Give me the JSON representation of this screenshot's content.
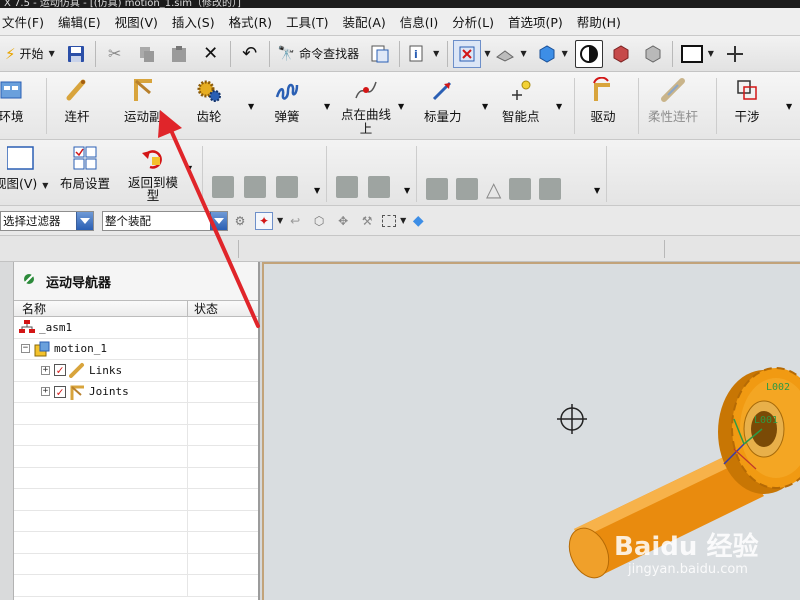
{
  "window": {
    "title": "X 7.5 - 运动仿真 - [(仿真) motion_1.sim（修改的）]"
  },
  "menu": {
    "items": [
      "文件(F)",
      "编辑(E)",
      "视图(V)",
      "插入(S)",
      "格式(R)",
      "工具(T)",
      "装配(A)",
      "信息(I)",
      "分析(L)",
      "首选项(P)",
      "帮助(H)"
    ]
  },
  "toolbar": {
    "start_label": "开始",
    "command_finder_label": "命令查找器"
  },
  "ribbon1": {
    "environment_label": "环境",
    "link_label": "连杆",
    "joint_label": "运动副",
    "gear_label": "齿轮",
    "spring_label": "弹簧",
    "point_on_curve_label": "点在曲线上",
    "scalar_force_label": "标量力",
    "smart_point_label": "智能点",
    "driver_label": "驱动",
    "flexible_link_label": "柔性连杆",
    "interference_label": "干涉"
  },
  "ribbon2": {
    "view_label": "视图(V)",
    "layout_settings_label": "布局设置",
    "return_to_model_label": "返回到模型"
  },
  "filterbar": {
    "selection_filter_value": "选择过滤器",
    "scope_value": "整个装配"
  },
  "navigator": {
    "title": "运动导航器",
    "columns": {
      "name": "名称",
      "status": "状态"
    },
    "rows": [
      {
        "name": "_asm1",
        "status": ""
      },
      {
        "name": "motion_1",
        "status": ""
      },
      {
        "name": "Links",
        "status": ""
      },
      {
        "name": "Joints",
        "status": ""
      }
    ]
  },
  "viewport": {
    "labels": {
      "l002": "L002",
      "l001": "L001"
    },
    "watermark_brand": "Baidu 经验",
    "watermark_url": "jingyan.baidu.com"
  },
  "colors": {
    "gear": "#f19a12",
    "arrow": "#e0252a",
    "viewport_bg": "#d9dde0"
  }
}
